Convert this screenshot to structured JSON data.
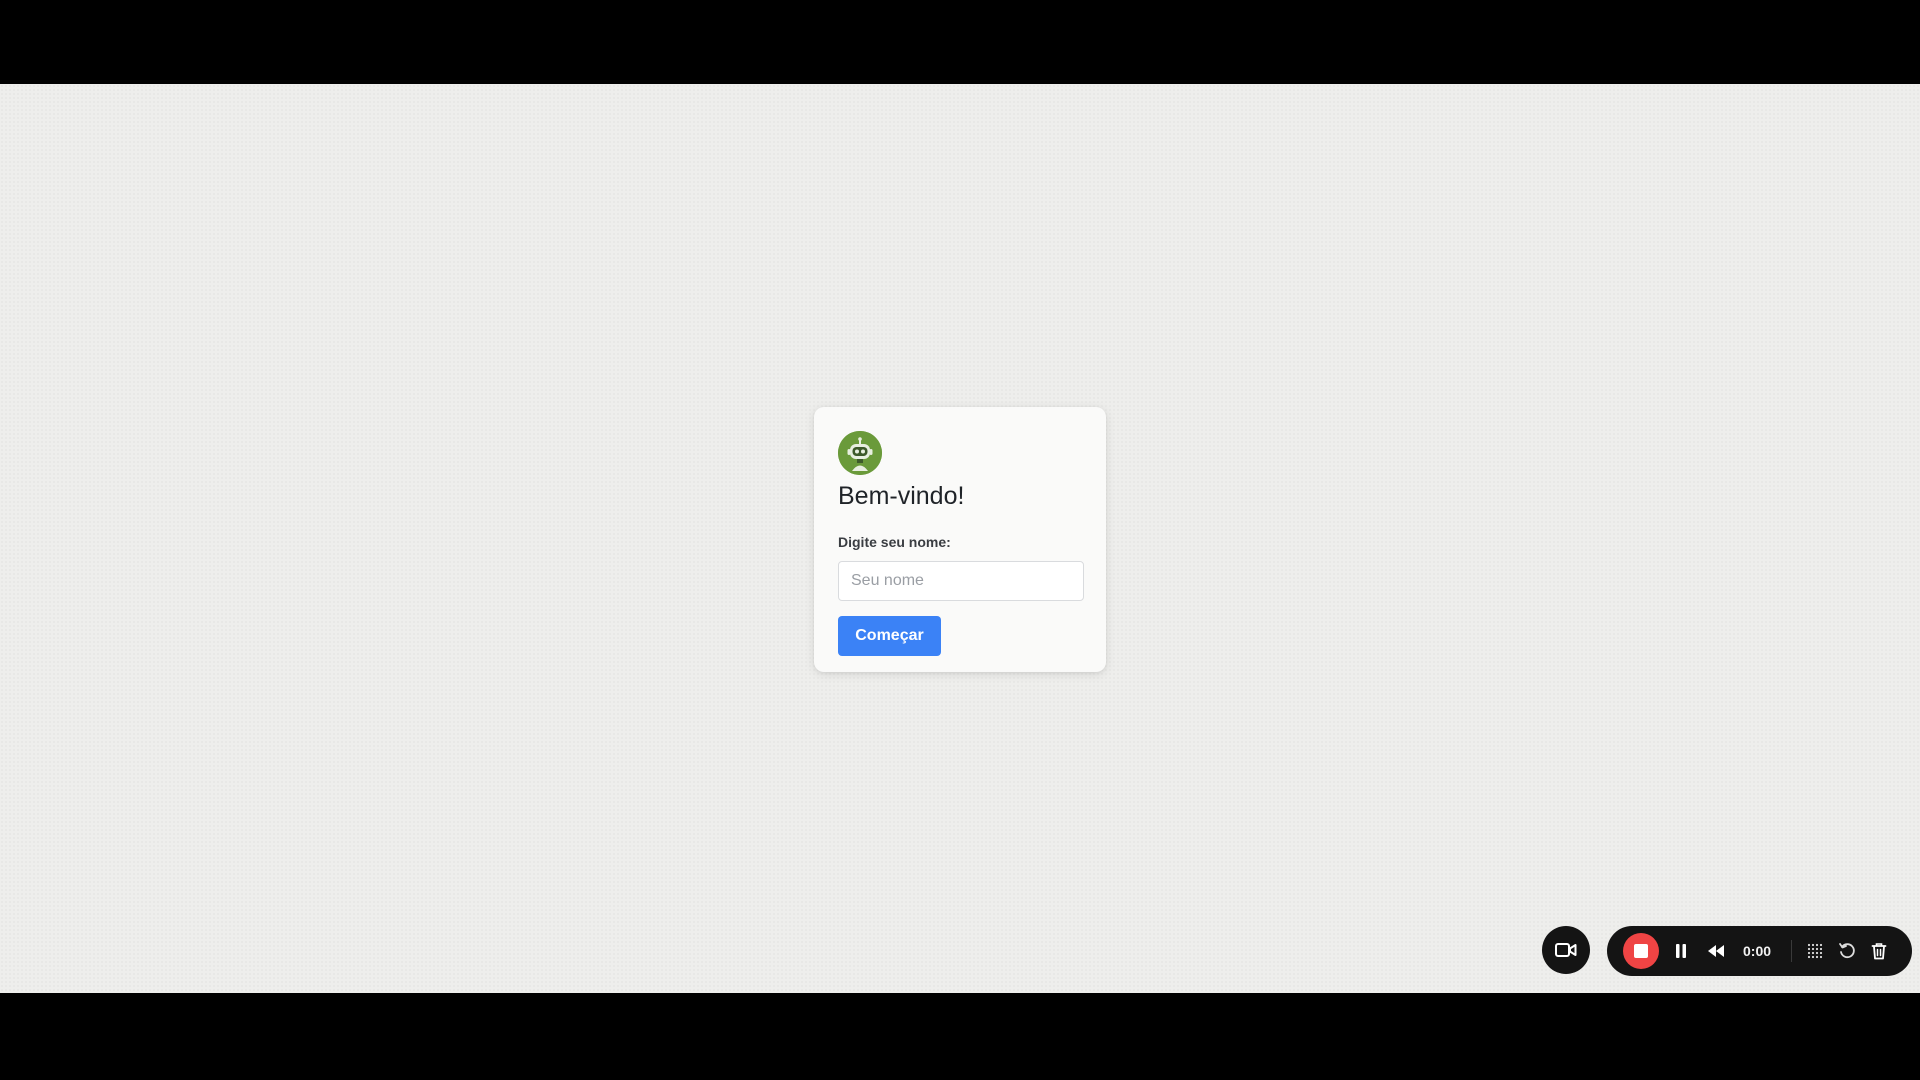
{
  "login_card": {
    "title": "Bem-vindo!",
    "name_label": "Digite seu nome:",
    "name_value": "",
    "name_placeholder": "Seu nome",
    "start_label": "Começar",
    "accent_color": "#3b82f6",
    "avatar_color": "#6a9a3a",
    "avatar_icon": "robot-avatar-icon"
  },
  "recorder": {
    "camera_icon": "video-camera-icon",
    "stop_icon": "stop-icon",
    "pause_icon": "pause-icon",
    "rewind_icon": "rewind-icon",
    "timer": "0:00",
    "grid_icon": "grid-dots-icon",
    "restart_icon": "restart-icon",
    "delete_icon": "trash-icon",
    "stop_color": "#ef4444"
  }
}
